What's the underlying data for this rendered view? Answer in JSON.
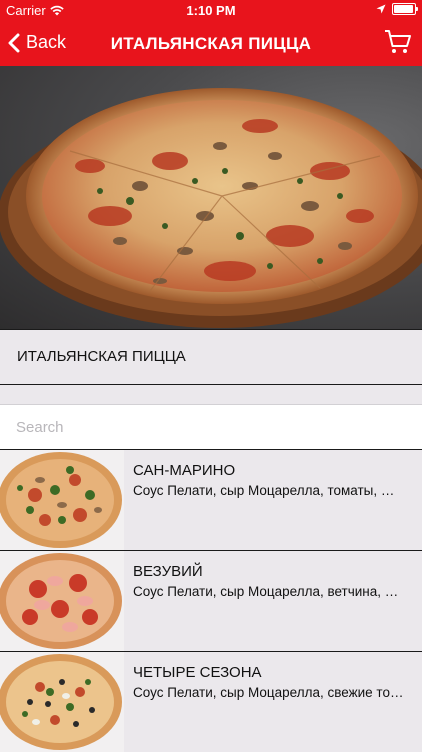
{
  "status_bar": {
    "carrier": "Carrier",
    "time": "1:10 PM",
    "icons": [
      "wifi-icon",
      "location-arrow-icon",
      "battery-icon"
    ]
  },
  "nav": {
    "back_label": "Back",
    "title": "ИТАЛЬЯНСКАЯ ПИЦЦА",
    "cart_icon": "cart-icon"
  },
  "category": {
    "title": "ИТАЛЬЯНСКАЯ ПИЦЦА"
  },
  "search": {
    "placeholder": "Search",
    "value": ""
  },
  "items": [
    {
      "name": "САН-МАРИНО",
      "description": "Соус Пелати, сыр Моцарелла, томаты, шампиньоны, зелень"
    },
    {
      "name": "ВЕЗУВИЙ",
      "description": "Соус Пелати, сыр Моцарелла, ветчина, салями"
    },
    {
      "name": "ЧЕТЫРЕ СЕЗОНА",
      "description": "Соус Пелати, сыр Моцарелла, свежие томаты, маслины"
    }
  ],
  "colors": {
    "brand_red": "#e8141c",
    "list_background": "#ebe8ec",
    "search_placeholder": "#b8b6ba"
  }
}
